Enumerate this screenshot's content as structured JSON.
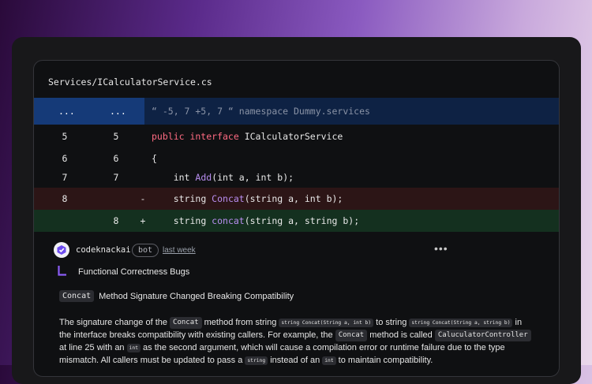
{
  "file": {
    "path": "Services/ICalculatorService.cs"
  },
  "hunk": {
    "old": "...",
    "new": "...",
    "header": "“ -5, 7 +5, 7 “ namespace Dummy.services"
  },
  "lines": [
    {
      "old": "5",
      "new": "5",
      "marker": "",
      "type": "context",
      "indent": "",
      "tokens": [
        {
          "t": "public interface ",
          "c": "kw"
        },
        {
          "t": "ICalculatorService",
          "c": ""
        }
      ]
    },
    {
      "old": "6",
      "new": "6",
      "marker": "",
      "type": "context",
      "indent": "",
      "tokens": [
        {
          "t": "{",
          "c": ""
        }
      ]
    },
    {
      "old": "7",
      "new": "7",
      "marker": "",
      "type": "context",
      "indent": "    ",
      "tokens": [
        {
          "t": "int ",
          "c": ""
        },
        {
          "t": "Add",
          "c": "fn"
        },
        {
          "t": "(int a, int b);",
          "c": ""
        }
      ]
    },
    {
      "old": "8",
      "new": "",
      "marker": "-",
      "type": "del",
      "indent": "    ",
      "tokens": [
        {
          "t": "string ",
          "c": ""
        },
        {
          "t": "Concat",
          "c": "fn"
        },
        {
          "t": "(string a, int b);",
          "c": ""
        }
      ]
    },
    {
      "old": "",
      "new": "8",
      "marker": "+",
      "type": "add",
      "indent": "    ",
      "tokens": [
        {
          "t": "string ",
          "c": ""
        },
        {
          "t": "concat",
          "c": "fn"
        },
        {
          "t": "(string a, string b);",
          "c": ""
        }
      ]
    }
  ],
  "comment": {
    "username": "codeknackai",
    "badge": "bot",
    "time": "last week",
    "more": "•••",
    "category": "Functional Correctness Bugs",
    "title_code": "Concat",
    "title_text": "Method Signature Changed Breaking Compatibility",
    "body": [
      {
        "t": "The signature change of the "
      },
      {
        "code": "Concat",
        "size": "md"
      },
      {
        "t": " method from string "
      },
      {
        "code": "string Concat(String a, int b)",
        "size": "sm"
      },
      {
        "t": " to string "
      },
      {
        "code": "string Concat(String a, string b)",
        "size": "sm"
      },
      {
        "t": " in the interface breaks compatibility with existing callers. For example, the "
      },
      {
        "code": "Concat",
        "size": "md"
      },
      {
        "t": " method is called "
      },
      {
        "code": "CaluculatorController",
        "size": "md"
      },
      {
        "t": " at line 25 with an "
      },
      {
        "code": "int",
        "size": "sm"
      },
      {
        "t": " as the second argument, which will cause a compilation error or runtime failure due to the type mismatch. All callers must be updated to pass a "
      },
      {
        "code": "string",
        "size": "sm"
      },
      {
        "t": " instead of an "
      },
      {
        "code": "int",
        "size": "sm"
      },
      {
        "t": " to maintain compatibility."
      }
    ]
  },
  "colors": {
    "keyword": "#ff6b82",
    "function": "#b88ef0",
    "hunk_bg": "#0e2244",
    "del_bg": "#2c1516",
    "add_bg": "#14301f",
    "accent": "#8b5cf6"
  },
  "icons": {
    "avatar": "codeknack-logo-icon",
    "category": "corner-bracket-icon"
  }
}
